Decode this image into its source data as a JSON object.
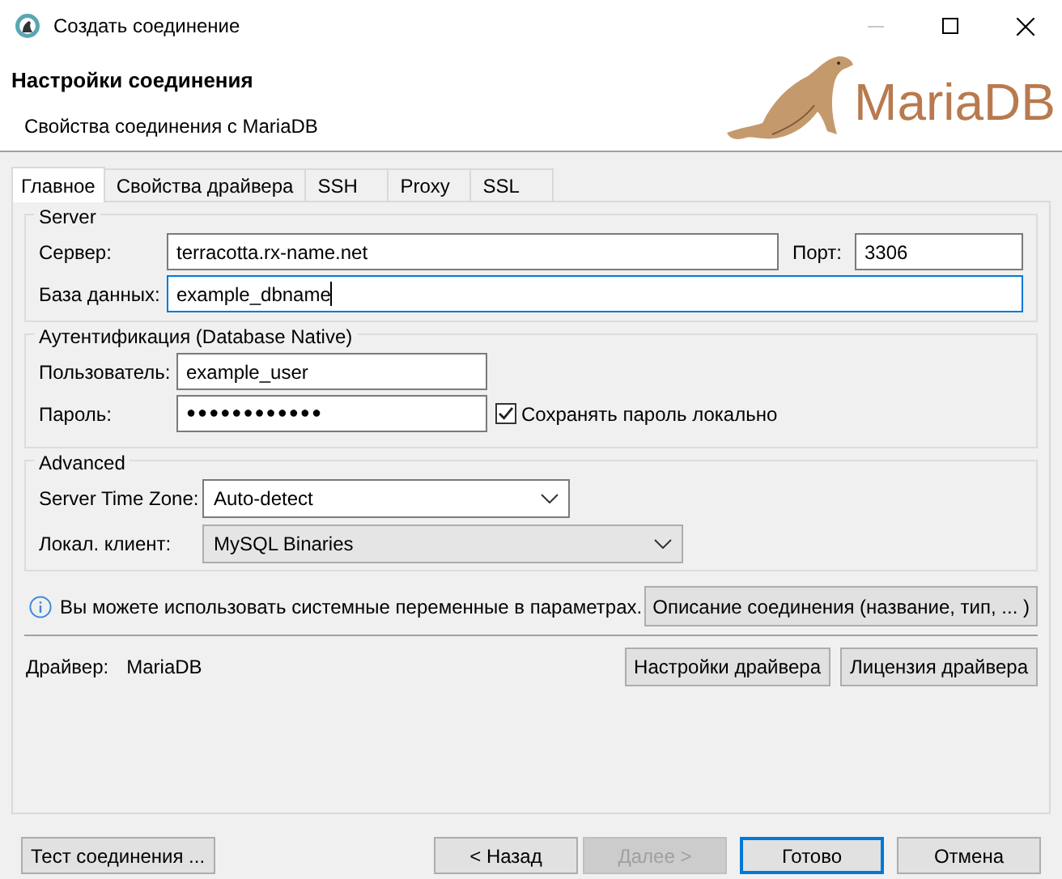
{
  "window": {
    "title": "Создать соединение",
    "controls": [
      {
        "kind": "minimize",
        "disabled": true
      },
      {
        "kind": "maximize",
        "disabled": false
      },
      {
        "kind": "close",
        "disabled": false
      }
    ]
  },
  "header": {
    "title": "Настройки соединения",
    "subtitle": "Свойства соединения с MariaDB",
    "logo_text": "MariaDB"
  },
  "tabs": [
    {
      "label": "Главное",
      "selected": true
    },
    {
      "label": "Свойства драйвера",
      "selected": false
    },
    {
      "label": "SSH",
      "selected": false
    },
    {
      "label": "Proxy",
      "selected": false
    },
    {
      "label": "SSL",
      "selected": false
    }
  ],
  "server": {
    "title": "Server",
    "host": {
      "label": "Сервер:",
      "value": "terracotta.rx-name.net",
      "focused": false
    },
    "port": {
      "label": "Порт:",
      "value": "3306",
      "focused": false
    },
    "database": {
      "label": "База данных:",
      "value": "example_dbname",
      "focused": true
    }
  },
  "auth": {
    "title": "Аутентификация (Database Native)",
    "user": {
      "label": "Пользователь:",
      "value": "example_user",
      "focused": false
    },
    "password": {
      "label": "Пароль:",
      "value": "●●●●●●●●●●●●",
      "focused": false
    },
    "save_password": {
      "label": "Сохранять пароль локально",
      "checked": true
    }
  },
  "advanced": {
    "title": "Advanced",
    "time_zone": {
      "label": "Server Time Zone:",
      "value": "Auto-detect",
      "readonly": false
    },
    "local_client": {
      "label": "Локал. клиент:",
      "value": "MySQL Binaries",
      "readonly": true
    }
  },
  "info": {
    "text": "Вы можете использовать системные переменные в параметрах.",
    "button": "Описание соединения (название, тип, ... )"
  },
  "driver": {
    "label": "Драйвер:",
    "value": "MariaDB",
    "buttons": [
      "Настройки драйвера",
      "Лицензия драйвера"
    ]
  },
  "footer_buttons": [
    {
      "label": "Тест соединения ...",
      "disabled": false,
      "default": false
    },
    {
      "label": "< Назад",
      "disabled": false,
      "default": false
    },
    {
      "label": "Далее >",
      "disabled": true,
      "default": false
    },
    {
      "label": "Готово",
      "disabled": false,
      "default": true
    },
    {
      "label": "Отмена",
      "disabled": false,
      "default": false
    }
  ]
}
